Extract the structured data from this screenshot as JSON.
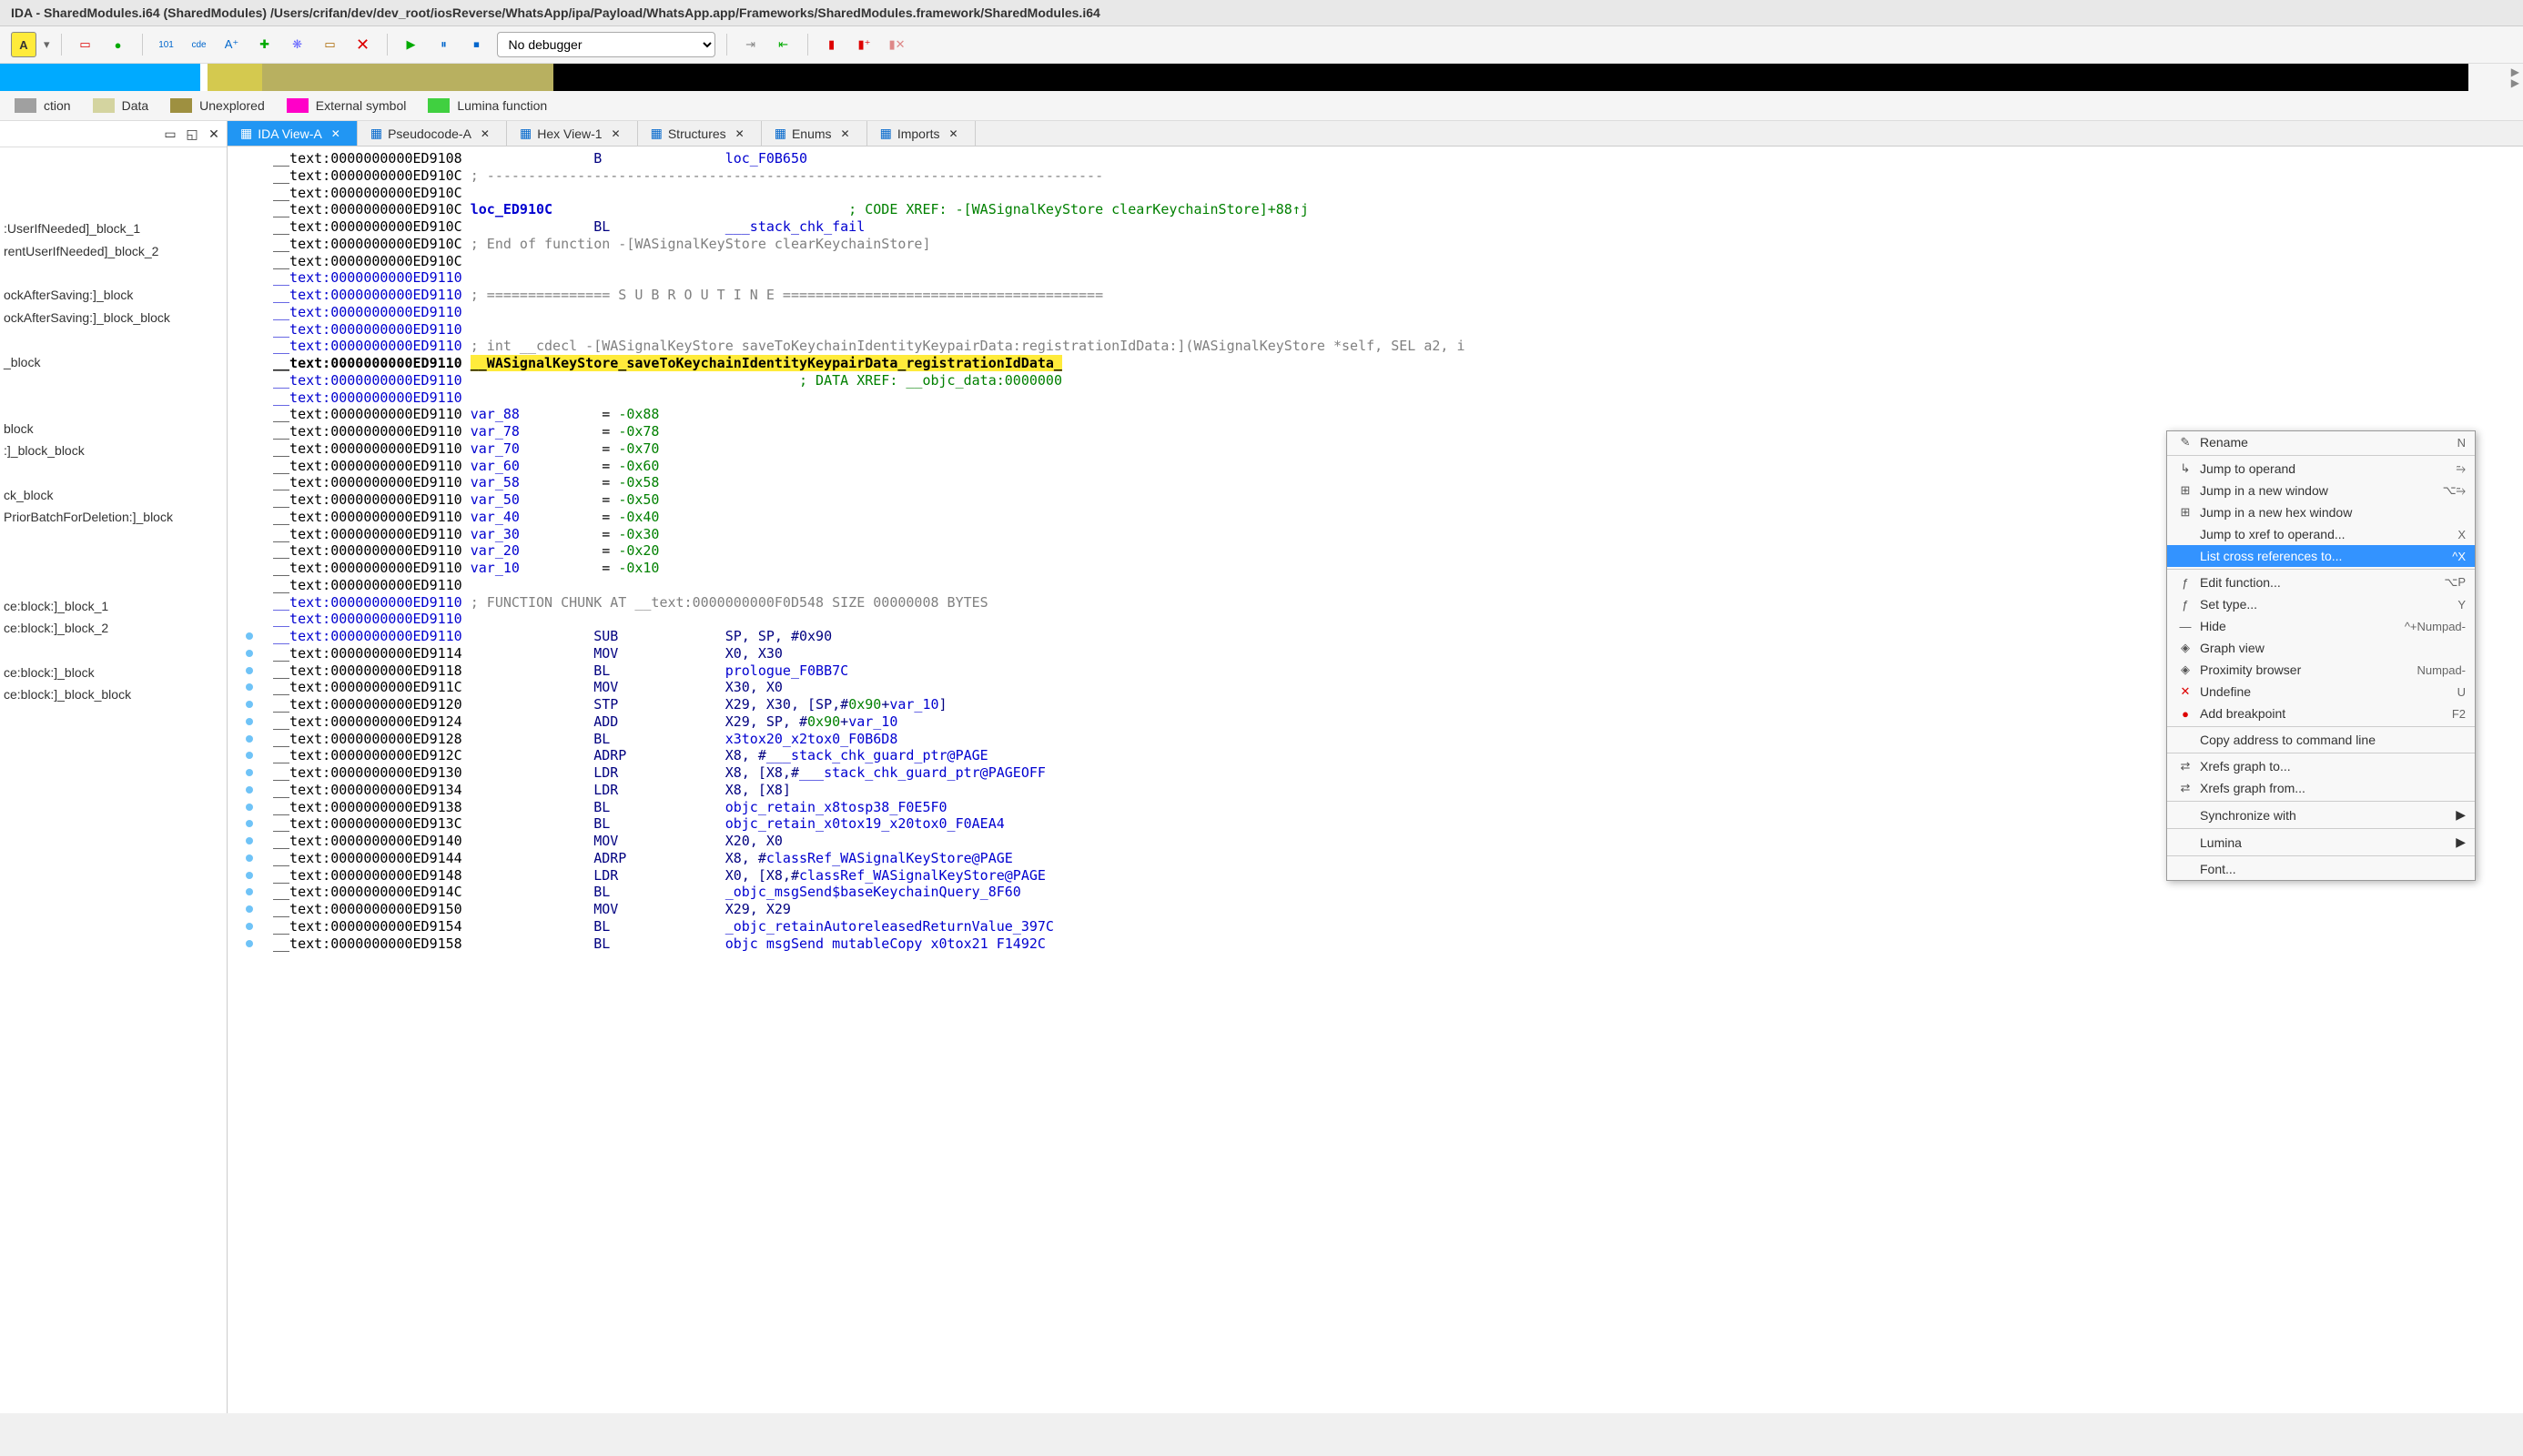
{
  "title": "IDA - SharedModules.i64 (SharedModules) /Users/crifan/dev/dev_root/iosReverse/WhatsApp/ipa/Payload/WhatsApp.app/Frameworks/SharedModules.framework/SharedModules.i64",
  "debugger": "No debugger",
  "legend": [
    {
      "label": "ction",
      "color": "#a0a0a0"
    },
    {
      "label": "Data",
      "color": "#d4d4a0"
    },
    {
      "label": "Unexplored",
      "color": "#9e9040"
    },
    {
      "label": "External symbol",
      "color": "#ff00c8"
    },
    {
      "label": "Lumina function",
      "color": "#40d040"
    }
  ],
  "functions": [
    "",
    "",
    "",
    ":UserIfNeeded]_block_1",
    "rentUserIfNeeded]_block_2",
    "",
    "ockAfterSaving:]_block",
    "ockAfterSaving:]_block_block",
    "",
    "_block",
    "",
    "",
    "block",
    ":]_block_block",
    "",
    "ck_block",
    "PriorBatchForDeletion:]_block",
    "",
    "",
    "",
    "ce:block:]_block_1",
    "ce:block:]_block_2",
    "",
    "ce:block:]_block",
    "ce:block:]_block_block"
  ],
  "tabs": [
    {
      "label": "IDA View-A",
      "active": true
    },
    {
      "label": "Pseudocode-A",
      "active": false
    },
    {
      "label": "Hex View-1",
      "active": false
    },
    {
      "label": "Structures",
      "active": false
    },
    {
      "label": "Enums",
      "active": false
    },
    {
      "label": "Imports",
      "active": false
    }
  ],
  "context_menu": [
    {
      "type": "item",
      "icon": "✎",
      "label": "Rename",
      "key": "N"
    },
    {
      "type": "sep"
    },
    {
      "type": "item",
      "icon": "↳",
      "label": "Jump to operand",
      "key": "⥲"
    },
    {
      "type": "item",
      "icon": "⊞",
      "label": "Jump in a new window",
      "key": "⌥⥲"
    },
    {
      "type": "item",
      "icon": "⊞",
      "label": "Jump in a new hex window",
      "key": ""
    },
    {
      "type": "item",
      "icon": "",
      "label": "Jump to xref to operand...",
      "key": "X"
    },
    {
      "type": "item",
      "icon": "",
      "label": "List cross references to...",
      "key": "^X",
      "selected": true
    },
    {
      "type": "sep"
    },
    {
      "type": "item",
      "icon": "ƒ",
      "label": "Edit function...",
      "key": "⌥P"
    },
    {
      "type": "item",
      "icon": "ƒ",
      "label": "Set type...",
      "key": "Y"
    },
    {
      "type": "item",
      "icon": "—",
      "label": "Hide",
      "key": "^+Numpad-"
    },
    {
      "type": "item",
      "icon": "◈",
      "label": "Graph view",
      "key": ""
    },
    {
      "type": "item",
      "icon": "◈",
      "label": "Proximity browser",
      "key": "Numpad-"
    },
    {
      "type": "item",
      "icon": "✕",
      "label": "Undefine",
      "key": "U",
      "iconColor": "#d00"
    },
    {
      "type": "item",
      "icon": "●",
      "label": "Add breakpoint",
      "key": "F2",
      "iconColor": "#d00"
    },
    {
      "type": "sep"
    },
    {
      "type": "item",
      "icon": "",
      "label": "Copy address to command line",
      "key": ""
    },
    {
      "type": "sep"
    },
    {
      "type": "item",
      "icon": "⇄",
      "label": "Xrefs graph to...",
      "key": ""
    },
    {
      "type": "item",
      "icon": "⇄",
      "label": "Xrefs graph from...",
      "key": ""
    },
    {
      "type": "sep"
    },
    {
      "type": "item",
      "icon": "",
      "label": "Synchronize with",
      "key": "",
      "submenu": true
    },
    {
      "type": "sep"
    },
    {
      "type": "item",
      "icon": "",
      "label": "Lumina",
      "key": "",
      "submenu": true
    },
    {
      "type": "sep"
    },
    {
      "type": "item",
      "icon": "",
      "label": "Font...",
      "key": ""
    }
  ],
  "disasm": [
    {
      "addr": "__text:0000000000ED9108",
      "mn": "B",
      "ops": "loc_F0B650",
      "opColor": "ref"
    },
    {
      "addr": "__text:0000000000ED910C",
      "cmt": "; ---------------------------------------------------------------------------"
    },
    {
      "addr": "__text:0000000000ED910C",
      "cmt": ""
    },
    {
      "addr": "__text:0000000000ED910C",
      "label": "loc_ED910C",
      "cmt": "; CODE XREF: -[WASignalKeyStore clearKeychainStore]+88↑j",
      "cmtColor": "green"
    },
    {
      "addr": "__text:0000000000ED910C",
      "mn": "BL",
      "ops": "___stack_chk_fail",
      "opColor": "ref"
    },
    {
      "addr": "__text:0000000000ED910C",
      "cmt": "; End of function -[WASignalKeyStore clearKeychainStore]"
    },
    {
      "addr": "__text:0000000000ED910C",
      "cmt": ""
    },
    {
      "addr": "__text:0000000000ED9110",
      "blue": true
    },
    {
      "addr": "__text:0000000000ED9110",
      "blue": true,
      "cmt": "; =============== S U B R O U T I N E ======================================="
    },
    {
      "addr": "__text:0000000000ED9110",
      "blue": true
    },
    {
      "addr": "__text:0000000000ED9110",
      "blue": true
    },
    {
      "addr": "__text:0000000000ED9110",
      "blue": true,
      "cmt": "; int __cdecl -[WASignalKeyStore saveToKeychainIdentityKeypairData:registrationIdData:](WASignalKeyStore *self, SEL a2, i"
    },
    {
      "addr": "__text:0000000000ED9110",
      "bold": true,
      "labelHL": "__WASignalKeyStore_saveToKeychainIdentityKeypairData_registrationIdData_"
    },
    {
      "addr": "__text:0000000000ED9110",
      "blue": true,
      "cmt2": "; DATA XREF: __objc_data:0000000"
    },
    {
      "addr": "__text:0000000000ED9110",
      "blue": true
    },
    {
      "addr": "__text:0000000000ED9110",
      "var": "var_88",
      "eq": "= -0x88"
    },
    {
      "addr": "__text:0000000000ED9110",
      "var": "var_78",
      "eq": "= -0x78"
    },
    {
      "addr": "__text:0000000000ED9110",
      "var": "var_70",
      "eq": "= -0x70"
    },
    {
      "addr": "__text:0000000000ED9110",
      "var": "var_60",
      "eq": "= -0x60"
    },
    {
      "addr": "__text:0000000000ED9110",
      "var": "var_58",
      "eq": "= -0x58"
    },
    {
      "addr": "__text:0000000000ED9110",
      "var": "var_50",
      "eq": "= -0x50"
    },
    {
      "addr": "__text:0000000000ED9110",
      "var": "var_40",
      "eq": "= -0x40"
    },
    {
      "addr": "__text:0000000000ED9110",
      "var": "var_30",
      "eq": "= -0x30"
    },
    {
      "addr": "__text:0000000000ED9110",
      "var": "var_20",
      "eq": "= -0x20"
    },
    {
      "addr": "__text:0000000000ED9110",
      "var": "var_10",
      "eq": "= -0x10"
    },
    {
      "addr": "__text:0000000000ED9110"
    },
    {
      "addr": "__text:0000000000ED9110",
      "blue": true,
      "cmt": "; FUNCTION CHUNK AT __text:0000000000F0D548 SIZE 00000008 BYTES"
    },
    {
      "addr": "__text:0000000000ED9110",
      "blue": true
    },
    {
      "addr": "__text:0000000000ED9110",
      "blue": true,
      "mn": "SUB",
      "raw": "SP, SP, #0x90",
      "dot": true,
      "dash": true
    },
    {
      "addr": "__text:0000000000ED9114",
      "mn": "MOV",
      "raw": "X0, X30",
      "dot": true
    },
    {
      "addr": "__text:0000000000ED9118",
      "mn": "BL",
      "ops": "prologue_F0BB7C",
      "opColor": "ref",
      "dot": true
    },
    {
      "addr": "__text:0000000000ED911C",
      "mn": "MOV",
      "raw": "X30, X0",
      "dot": true
    },
    {
      "addr": "__text:0000000000ED9120",
      "mn": "STP",
      "raw3": "X29, X30, [SP,#0x90+var_10]",
      "dot": true
    },
    {
      "addr": "__text:0000000000ED9124",
      "mn": "ADD",
      "raw3": "X29, SP, #0x90+var_10",
      "dot": true
    },
    {
      "addr": "__text:0000000000ED9128",
      "mn": "BL",
      "ops": "x3tox20_x2tox0_F0B6D8",
      "opColor": "ref",
      "dot": true
    },
    {
      "addr": "__text:0000000000ED912C",
      "mn": "ADRP",
      "raw4": "X8, #___stack_chk_guard_ptr@PAGE",
      "dot": true
    },
    {
      "addr": "__text:0000000000ED9130",
      "mn": "LDR",
      "raw4": "X8, [X8,#___stack_chk_guard_ptr@PAGEOFF",
      "dot": true
    },
    {
      "addr": "__text:0000000000ED9134",
      "mn": "LDR",
      "raw": "X8, [X8]",
      "dot": true
    },
    {
      "addr": "__text:0000000000ED9138",
      "mn": "BL",
      "ops": "objc_retain_x8tosp38_F0E5F0",
      "opColor": "ref",
      "dot": true
    },
    {
      "addr": "__text:0000000000ED913C",
      "mn": "BL",
      "ops": "objc_retain_x0tox19_x20tox0_F0AEA4",
      "opColor": "ref",
      "dot": true
    },
    {
      "addr": "__text:0000000000ED9140",
      "mn": "MOV",
      "raw": "X20, X0",
      "dot": true
    },
    {
      "addr": "__text:0000000000ED9144",
      "mn": "ADRP",
      "raw4": "X8, #classRef_WASignalKeyStore@PAGE",
      "dot": true
    },
    {
      "addr": "__text:0000000000ED9148",
      "mn": "LDR",
      "raw4": "X0, [X8,#classRef_WASignalKeyStore@PAGE",
      "dot": true
    },
    {
      "addr": "__text:0000000000ED914C",
      "mn": "BL",
      "ops": "_objc_msgSend$baseKeychainQuery_8F60",
      "opColor": "ref",
      "dot": true
    },
    {
      "addr": "__text:0000000000ED9150",
      "mn": "MOV",
      "raw": "X29, X29",
      "dot": true
    },
    {
      "addr": "__text:0000000000ED9154",
      "mn": "BL",
      "ops": "_objc_retainAutoreleasedReturnValue_397C",
      "opColor": "ref",
      "dot": true
    },
    {
      "addr": "__text:0000000000ED9158",
      "mn": "BL",
      "ops": "objc msgSend mutableCopy x0tox21 F1492C",
      "opColor": "ref",
      "dot": true
    }
  ]
}
